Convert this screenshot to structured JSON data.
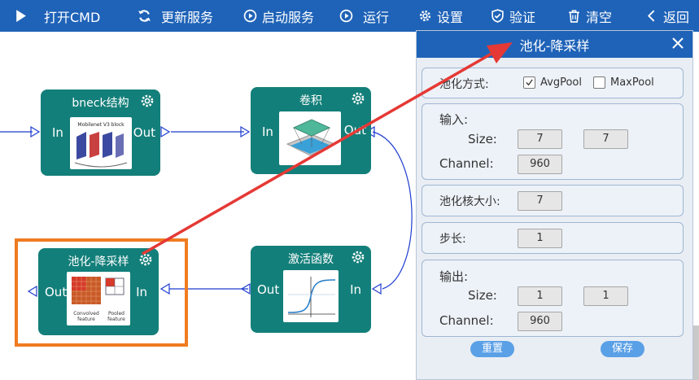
{
  "toolbar": {
    "items": [
      {
        "label": "打开CMD",
        "icon": "play-icon"
      },
      {
        "label": "更新服务",
        "icon": "refresh-icon"
      },
      {
        "label": "启动服务",
        "icon": "power-icon"
      },
      {
        "label": "运行",
        "icon": "run-icon"
      },
      {
        "label": "设置",
        "icon": "gear-icon"
      },
      {
        "label": "验证",
        "icon": "shield-icon"
      },
      {
        "label": "清空",
        "icon": "trash-icon"
      },
      {
        "label": "返回",
        "icon": "back-icon"
      }
    ]
  },
  "nodes": {
    "bneck": {
      "title": "bneck结构",
      "in": "In",
      "out": "Out",
      "thumb_text": "Mobilenet V3 block"
    },
    "conv": {
      "title": "卷积",
      "in": "In",
      "out": "Out"
    },
    "pool": {
      "title": "池化-降采样",
      "in": "In",
      "out": "Out",
      "thumb_left": "Convolved feature",
      "thumb_right": "Pooled feature"
    },
    "act": {
      "title": "激活函数",
      "in": "In",
      "out": "Out"
    }
  },
  "dialog": {
    "title": "池化-降采样",
    "pool_type_label": "池化方式:",
    "avg_label": "AvgPool",
    "max_label": "MaxPool",
    "avg_checked": true,
    "max_checked": false,
    "input": {
      "label": "输入:",
      "size_label": "Size:",
      "size_w": "7",
      "size_h": "7",
      "channel_label": "Channel:",
      "channel": "960"
    },
    "kernel": {
      "label": "池化核大小:",
      "value": "7"
    },
    "stride": {
      "label": "步长:",
      "value": "1"
    },
    "output": {
      "label": "输出:",
      "size_label": "Size:",
      "size_w": "1",
      "size_h": "1",
      "channel_label": "Channel:",
      "channel": "960"
    },
    "reset_label": "重置",
    "save_label": "保存"
  },
  "colors": {
    "toolbar": "#1f63b8",
    "node": "#137f7a",
    "highlight": "#f07c22",
    "arrow": "#e53935",
    "wire": "#1e3ccf"
  }
}
